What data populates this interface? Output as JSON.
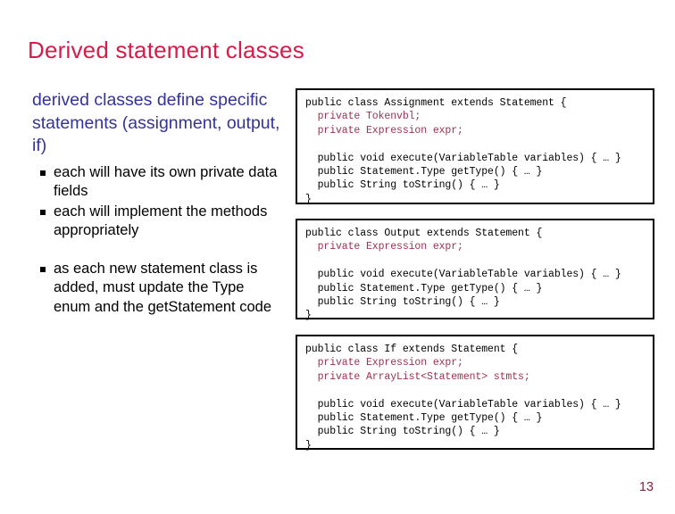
{
  "slide": {
    "title": "Derived statement classes",
    "page_number": "13",
    "colors": {
      "title": "#d81b4a",
      "lead_bullet": "#333399",
      "sub_bullet": "#000000",
      "code_declaration": "#a03050",
      "code_body": "#000000",
      "box_border": "#000000",
      "page_number": "#8c2040"
    }
  },
  "content": {
    "lead_bullet": "derived classes define specific statements (assignment, output, if)",
    "sub_bullets": [
      "each will have its own private data fields",
      "each will implement the methods appropriately",
      "as each new statement class is added, must update the Type enum and the getStatement code"
    ],
    "bullet_glyph": "square-bullet"
  },
  "code_boxes": [
    {
      "name": "assignment-class",
      "lines": [
        {
          "text": "public class Assignment extends Statement {",
          "style": "body"
        },
        {
          "text": "  private Tokenvbl;",
          "style": "decl"
        },
        {
          "text": "  private Expression expr;",
          "style": "decl"
        },
        {
          "text": "",
          "style": "blank"
        },
        {
          "text": "  public void execute(VariableTable variables) { … }",
          "style": "body"
        },
        {
          "text": "  public Statement.Type getType() { … }",
          "style": "body"
        },
        {
          "text": "  public String toString() { … }",
          "style": "body"
        },
        {
          "text": "}",
          "style": "body"
        }
      ]
    },
    {
      "name": "output-class",
      "lines": [
        {
          "text": "public class Output extends Statement {",
          "style": "body"
        },
        {
          "text": "  private Expression expr;",
          "style": "decl"
        },
        {
          "text": "",
          "style": "blank"
        },
        {
          "text": "  public void execute(VariableTable variables) { … }",
          "style": "body"
        },
        {
          "text": "  public Statement.Type getType() { … }",
          "style": "body"
        },
        {
          "text": "  public String toString() { … }",
          "style": "body"
        },
        {
          "text": "}",
          "style": "body"
        }
      ]
    },
    {
      "name": "if-class",
      "lines": [
        {
          "text": "public class If extends Statement {",
          "style": "body"
        },
        {
          "text": "  private Expression expr;",
          "style": "decl"
        },
        {
          "text": "  private ArrayList<Statement> stmts;",
          "style": "decl"
        },
        {
          "text": "",
          "style": "blank"
        },
        {
          "text": "  public void execute(VariableTable variables) { … }",
          "style": "body"
        },
        {
          "text": "  public Statement.Type getType() { … }",
          "style": "body"
        },
        {
          "text": "  public String toString() { … }",
          "style": "body"
        },
        {
          "text": "}",
          "style": "body"
        }
      ]
    }
  ]
}
